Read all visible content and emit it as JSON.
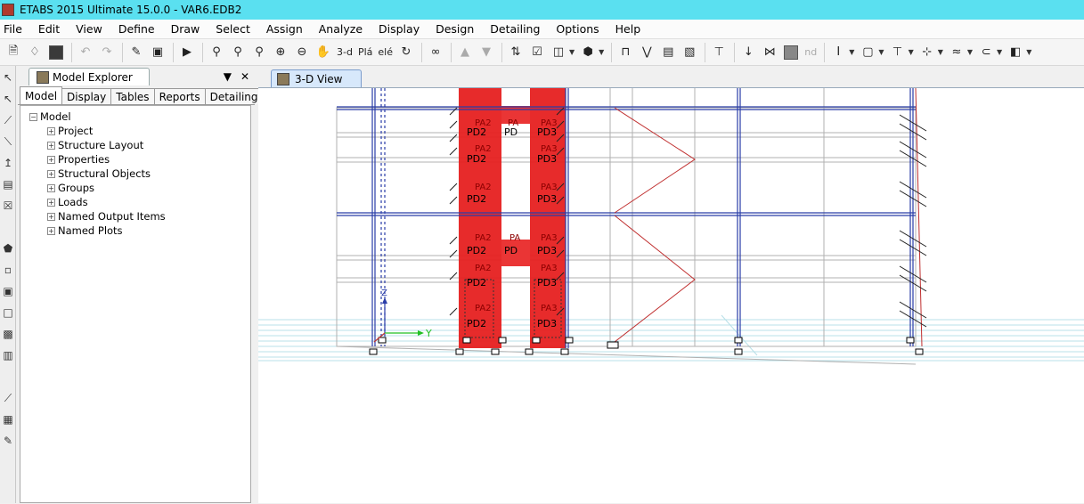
{
  "window": {
    "title": "ETABS 2015 Ultimate 15.0.0 - VAR6.EDB2"
  },
  "menu": [
    "File",
    "Edit",
    "View",
    "Define",
    "Draw",
    "Select",
    "Assign",
    "Analyze",
    "Display",
    "Design",
    "Detailing",
    "Options",
    "Help"
  ],
  "toolbar": {
    "view3d_label": "3-d",
    "plan_label": "Plá",
    "elev_label": "elé",
    "nd_label": "nd"
  },
  "explorer": {
    "title": "Model Explorer",
    "tabs": [
      "Model",
      "Display",
      "Tables",
      "Reports",
      "Detailing"
    ],
    "active_tab": "Model",
    "tree_root": "Model",
    "tree_items": [
      "Project",
      "Structure Layout",
      "Properties",
      "Structural Objects",
      "Groups",
      "Loads",
      "Named Output Items",
      "Named Plots"
    ]
  },
  "view": {
    "tab_label": "3-D View",
    "axis_z": "Z",
    "axis_y": "Y",
    "pier_labels": [
      "PA2",
      "PD2",
      "PA",
      "PD",
      "PA3",
      "PD3"
    ]
  },
  "colors": {
    "titlebar": "#5ae0f0",
    "frame_blue": "#2a3da8",
    "wall_red": "#e62020",
    "grid_gray": "#b0b0b0",
    "brace_red": "#c03030"
  }
}
